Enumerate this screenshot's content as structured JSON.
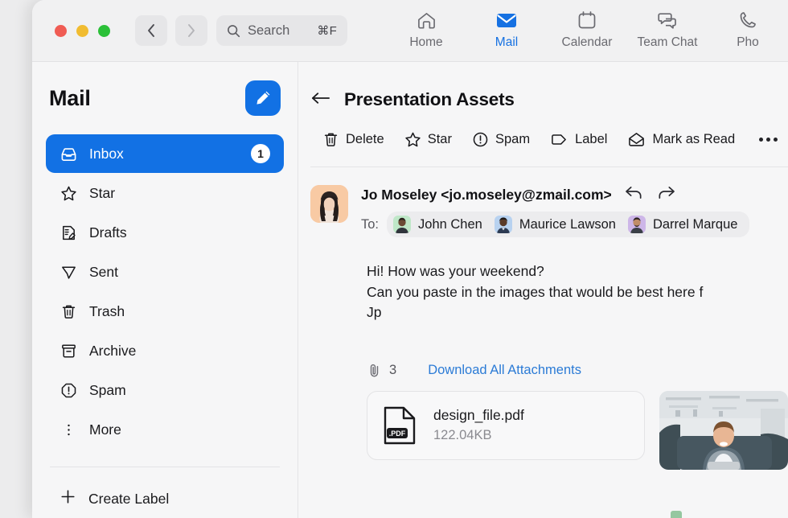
{
  "window": {
    "traffic_lights": [
      "close",
      "minimize",
      "maximize"
    ],
    "back_label": "Back",
    "forward_label": "Forward"
  },
  "search": {
    "placeholder": "Search",
    "shortcut": "⌘F",
    "icon": "search-icon"
  },
  "nav_tabs": [
    {
      "label": "Home",
      "icon": "home-icon",
      "active": false
    },
    {
      "label": "Mail",
      "icon": "mail-icon",
      "active": true
    },
    {
      "label": "Calendar",
      "icon": "calendar-icon",
      "active": false
    },
    {
      "label": "Team Chat",
      "icon": "chat-bubbles-icon",
      "active": false
    },
    {
      "label": "Pho",
      "icon": "phone-icon",
      "active": false
    }
  ],
  "sidebar": {
    "title": "Mail",
    "compose_icon": "pencil-icon",
    "items": [
      {
        "label": "Inbox",
        "icon": "inbox-icon",
        "badge": "1",
        "selected": true
      },
      {
        "label": "Star",
        "icon": "star-icon",
        "badge": "",
        "selected": false
      },
      {
        "label": "Drafts",
        "icon": "drafts-icon",
        "badge": "",
        "selected": false
      },
      {
        "label": "Sent",
        "icon": "send-icon",
        "badge": "",
        "selected": false
      },
      {
        "label": "Trash",
        "icon": "trash-icon",
        "badge": "",
        "selected": false
      },
      {
        "label": "Archive",
        "icon": "archive-icon",
        "badge": "",
        "selected": false
      },
      {
        "label": "Spam",
        "icon": "spam-icon",
        "badge": "",
        "selected": false
      },
      {
        "label": "More",
        "icon": "more-vertical-icon",
        "badge": "",
        "selected": false
      }
    ],
    "create_label": {
      "label": "Create Label",
      "icon": "plus-icon"
    }
  },
  "main": {
    "back_icon": "arrow-left-icon",
    "subject": "Presentation Assets",
    "toolbar": [
      {
        "label": "Delete",
        "icon": "trash-icon"
      },
      {
        "label": "Star",
        "icon": "star-icon"
      },
      {
        "label": "Spam",
        "icon": "spam-icon"
      },
      {
        "label": "Label",
        "icon": "label-tag-icon"
      },
      {
        "label": "Mark as Read",
        "icon": "envelope-open-icon"
      }
    ],
    "more_icon": "more-horizontal-icon"
  },
  "message": {
    "sender": "Jo Moseley <jo.moseley@zmail.com>",
    "sender_avatar": "woman-long-dark-hair-avatar",
    "reply_icon": "reply-arrow-icon",
    "forward_icon": "forward-arrow-icon",
    "to_label": "To:",
    "recipients": [
      {
        "name": "John Chen",
        "avatar_color": "#bfe7c8"
      },
      {
        "name": "Maurice Lawson",
        "avatar_color": "#b8d2f0"
      },
      {
        "name": "Darrel Marque",
        "avatar_color": "#cdb6e8"
      }
    ],
    "body_lines": [
      "Hi! How was your weekend?",
      "Can you paste in the images that would be best here f",
      "Jp"
    ]
  },
  "attachments": {
    "clip_icon": "paperclip-icon",
    "count": "3",
    "download_all_label": "Download All Attachments",
    "items": [
      {
        "type": "pdf",
        "name": "design_file.pdf",
        "size": "122.04KB",
        "icon": "pdf-file-icon",
        "badge_text": ".PDF"
      },
      {
        "type": "image",
        "name": "photo-thumbnail",
        "size": "",
        "icon": "image-thumbnail"
      }
    ]
  },
  "colors": {
    "accent": "#1271e4",
    "link": "#2b7bd6",
    "text": "#1a1a1d",
    "muted": "#56565c",
    "window_bg": "#f6f6f7",
    "topbar_bg": "#f1f1f2",
    "divider": "#e4e4e6"
  }
}
